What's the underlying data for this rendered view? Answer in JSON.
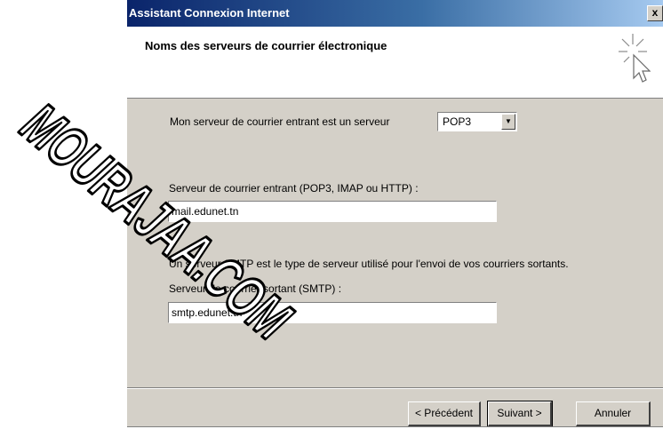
{
  "window": {
    "title": "Assistant Connexion Internet",
    "close_glyph": "x"
  },
  "header": {
    "title": "Noms des serveurs de courrier électronique",
    "icon": "wizard-sparkle-cursor-icon"
  },
  "form": {
    "server_type_label": "Mon serveur de courrier entrant est un serveur",
    "server_type_value": "POP3",
    "incoming_label": "Serveur de courrier entrant (POP3, IMAP ou HTTP) :",
    "incoming_value": "mail.edunet.tn",
    "smtp_info": "Un serveur SMTP est le type de serveur utilisé pour l'envoi de vos courriers sortants.",
    "outgoing_label": "Serveur de courrier sortant (SMTP) :",
    "outgoing_value": "smtp.edunet.tn"
  },
  "buttons": {
    "back": "< Précédent",
    "next": "Suivant >",
    "cancel": "Annuler"
  },
  "watermark": {
    "text": "MOURAJAA.COM"
  }
}
